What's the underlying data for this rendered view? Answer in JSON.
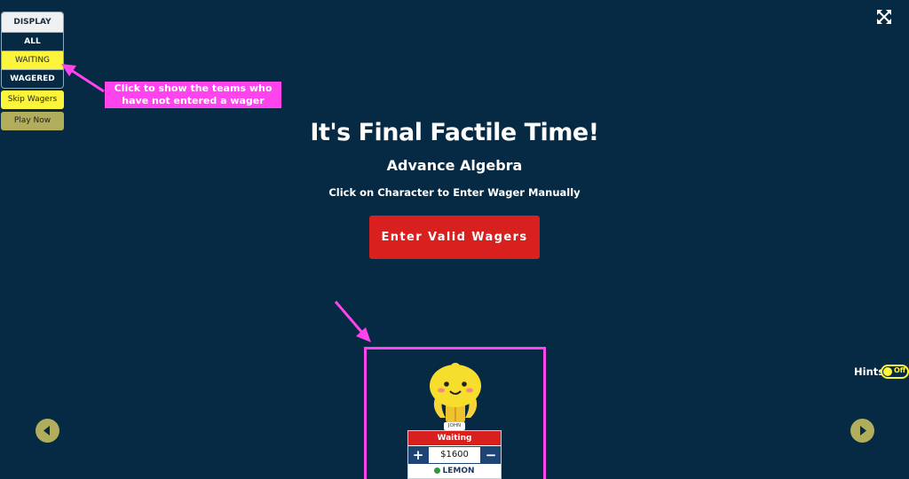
{
  "display_panel": {
    "header": "DISPLAY",
    "options": [
      "ALL",
      "WAITING",
      "WAGERED"
    ],
    "active_option": "WAITING"
  },
  "buttons": {
    "skip_wagers": "Skip Wagers",
    "play_now": "Play Now",
    "enter_valid_wagers": "Enter Valid Wagers"
  },
  "annotation": {
    "text": "Click to show the teams who have not entered a wager"
  },
  "main": {
    "title": "It's Final Factile Time!",
    "subtitle": "Advance Algebra",
    "instructions": "Click on Character to Enter Wager Manually"
  },
  "hints": {
    "label": "Hints",
    "state": "Off"
  },
  "team": {
    "player_name": "JOHN",
    "status": "Waiting",
    "wager": "$1600",
    "team_name": "LEMON"
  },
  "colors": {
    "background": "#062a44",
    "accent_yellow": "#fdf53c",
    "olive": "#b0ae5c",
    "red": "#d8201f",
    "annotation_pink": "#ff44ee"
  },
  "icons": [
    "expand-icon",
    "chevron-left-icon",
    "chevron-right-icon",
    "plus-icon",
    "minus-icon",
    "lemon-character-icon"
  ]
}
